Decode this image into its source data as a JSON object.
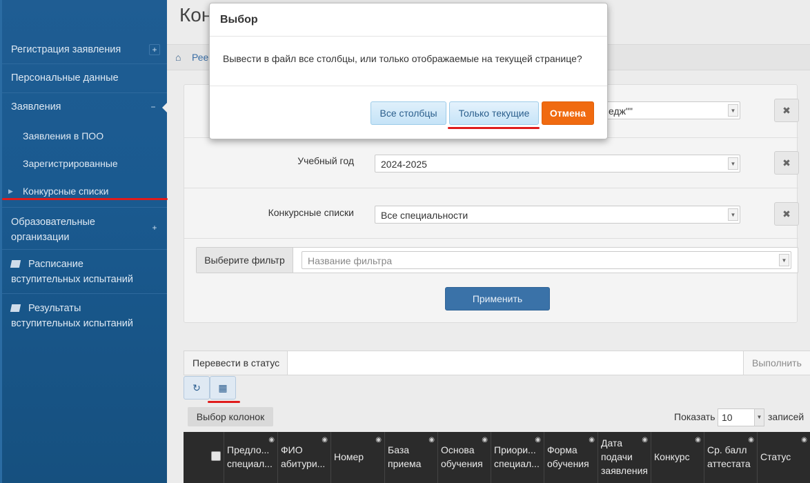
{
  "sidebar": {
    "items": [
      {
        "label": "Регистрация заявления",
        "toggle": "+"
      },
      {
        "label": "Персональные данные"
      },
      {
        "label": "Заявления",
        "toggle": "−"
      },
      {
        "label": "Заявления в ПОО"
      },
      {
        "label": "Зарегистрированные"
      },
      {
        "label": "Конкурсные списки"
      },
      {
        "label_line1": "Образовательные",
        "label_line2": "организации",
        "toggle": "+"
      },
      {
        "label_line1": "Расписание",
        "label_line2": "вступительных испытаний",
        "icon": "book-icon"
      },
      {
        "label_line1": "Результаты",
        "label_line2": "вступительных испытаний",
        "icon": "book-icon"
      }
    ]
  },
  "main": {
    "title": "Кон",
    "breadcrumb": "Рее",
    "filters": {
      "org_value": "едж\"\"",
      "year_label": "Учебный год",
      "year_value": "2024-2025",
      "lists_label": "Конкурсные списки",
      "lists_value": "Все специальности",
      "filter_label": "Выберите фильтр",
      "filter_placeholder": "Название фильтра",
      "clear_symbol": "✖",
      "apply_label": "Применить"
    },
    "status_bar": {
      "label": "Перевести в статус",
      "run_label": "Выполнить"
    },
    "columns_button": "Выбор колонок",
    "show_label": "Показать",
    "show_value": "10",
    "records_label": "записей",
    "table_headers": [
      {
        "l1": "Предло...",
        "l2": "специал..."
      },
      {
        "l1": "ФИО",
        "l2": "абитури..."
      },
      {
        "l1": "Номер"
      },
      {
        "l1": "База",
        "l2": "приема"
      },
      {
        "l1": "Основа",
        "l2": "обучения"
      },
      {
        "l1": "Приори...",
        "l2": "специал..."
      },
      {
        "l1": "Форма",
        "l2": "обучения"
      },
      {
        "l1": "Дата",
        "l2": "подачи",
        "l3": "заявления"
      },
      {
        "l1": "Конкурс"
      },
      {
        "l1": "Ср. балл",
        "l2": "аттестата"
      },
      {
        "l1": "Статус"
      }
    ]
  },
  "dialog": {
    "title": "Выбор",
    "message": "Вывести в файл все столбцы, или только отображаемые на текущей странице?",
    "buttons": {
      "all": "Все столбцы",
      "current": "Только текущие",
      "cancel": "Отмена"
    }
  },
  "colors": {
    "sidebar": "#1a5a90",
    "accent_orange": "#f06a10",
    "highlight_red": "#e01b1b",
    "apply_blue": "#3a72a8"
  }
}
